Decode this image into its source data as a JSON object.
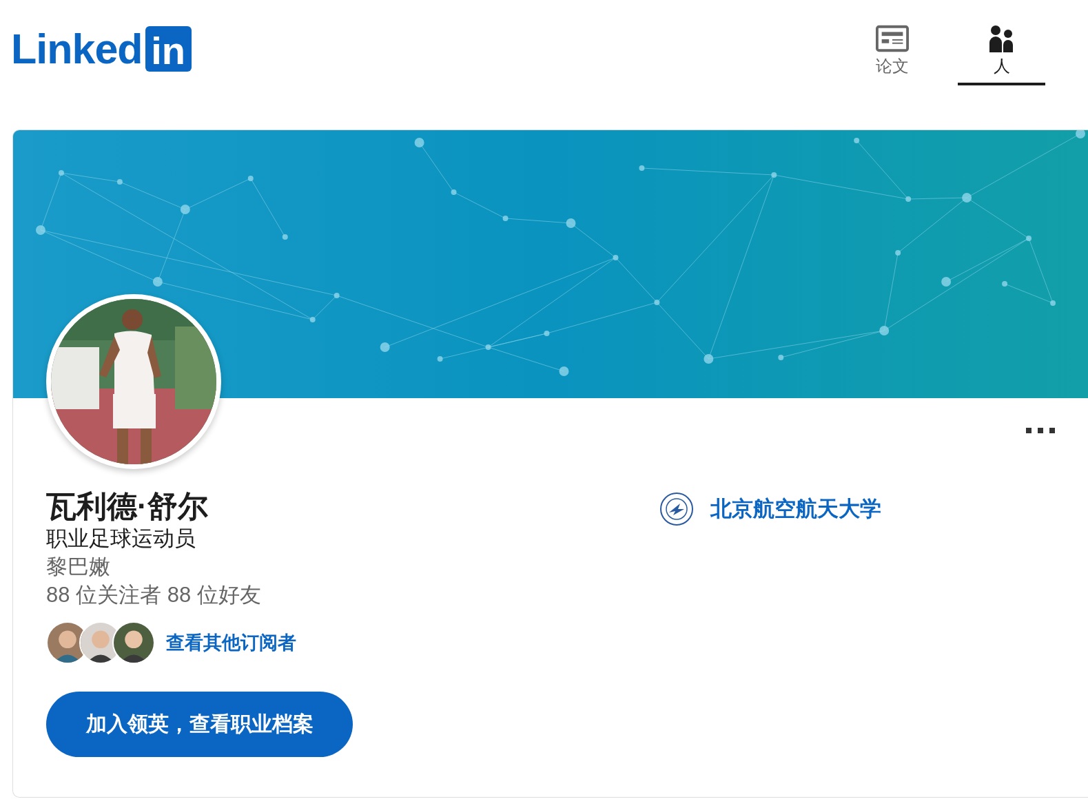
{
  "logo": {
    "text": "Linked",
    "badge": "in"
  },
  "tabs": [
    {
      "label": "论文",
      "selected": false
    },
    {
      "label": "人",
      "selected": true
    }
  ],
  "profile": {
    "name": "瓦利德·舒尔",
    "headline": "职业足球运动员",
    "location": "黎巴嫩",
    "stats": "88 位关注者 88 位好友",
    "followers_link": "查看其他订阅者",
    "join_button": "加入领英，查看职业档案",
    "education": "北京航空航天大学"
  }
}
